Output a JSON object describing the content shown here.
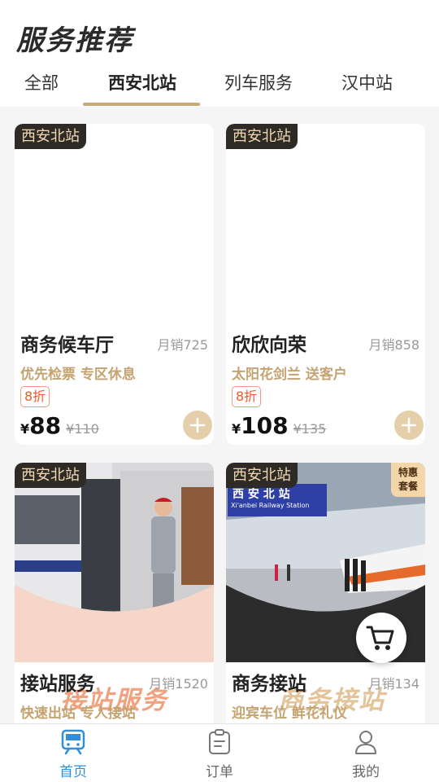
{
  "page": {
    "title": "服务推荐"
  },
  "tabs": [
    {
      "label": "全部",
      "active": false
    },
    {
      "label": "西安北站",
      "active": true
    },
    {
      "label": "列车服务",
      "active": false
    },
    {
      "label": "汉中站",
      "active": false
    }
  ],
  "products": [
    {
      "station": "西安北站",
      "name": "商务候车厅",
      "sales": "月销725",
      "features": "优先检票  专区休息",
      "discount": "8折",
      "currency": "¥",
      "price": "88",
      "original_price": "¥110"
    },
    {
      "station": "西安北站",
      "name": "欣欣向荣",
      "sales": "月销858",
      "features": "太阳花剑兰  送客户",
      "discount": "8折",
      "currency": "¥",
      "price": "108",
      "original_price": "¥135"
    },
    {
      "station": "西安北站",
      "name": "接站服务",
      "sales": "月销1520",
      "features": "快速出站  专人接站",
      "promo_text": "接站服务"
    },
    {
      "station": "西安北站",
      "name": "商务接站",
      "sales": "月销134",
      "features": "迎宾车位  鲜花礼仪",
      "promo_text": "商务接站",
      "special_tag": [
        "特惠",
        "套餐"
      ],
      "sign_text": "西 安 北 站",
      "sign_subtext": "Xi'anbei Railway Station"
    }
  ],
  "icons": {
    "add": "plus-icon",
    "cart": "cart-icon",
    "home": "train-icon",
    "orders": "clipboard-icon",
    "profile": "user-icon"
  },
  "nav": [
    {
      "label": "首页",
      "active": true
    },
    {
      "label": "订单",
      "active": false
    },
    {
      "label": "我的",
      "active": false
    }
  ],
  "colors": {
    "accent_gold": "#c9a97a",
    "tag_dark": "#2e2a26",
    "discount_red": "#f05a2a",
    "nav_active": "#2f8fd8",
    "add_button": "#e5cfaa"
  }
}
